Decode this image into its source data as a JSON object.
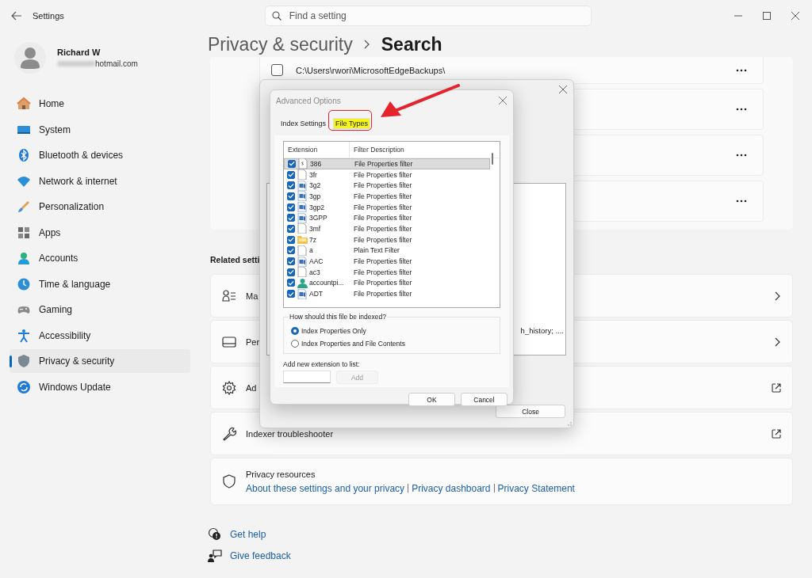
{
  "window": {
    "title": "Settings"
  },
  "search": {
    "placeholder": "Find a setting"
  },
  "profile": {
    "name": "Richard W",
    "email": "hotmail.com"
  },
  "nav": [
    {
      "label": "Home",
      "selected": false
    },
    {
      "label": "System",
      "selected": false
    },
    {
      "label": "Bluetooth & devices",
      "selected": false
    },
    {
      "label": "Network & internet",
      "selected": false
    },
    {
      "label": "Personalization",
      "selected": false
    },
    {
      "label": "Apps",
      "selected": false
    },
    {
      "label": "Accounts",
      "selected": false
    },
    {
      "label": "Time & language",
      "selected": false
    },
    {
      "label": "Gaming",
      "selected": false
    },
    {
      "label": "Accessibility",
      "selected": false
    },
    {
      "label": "Privacy & security",
      "selected": true
    },
    {
      "label": "Windows Update",
      "selected": false
    }
  ],
  "breadcrumb": {
    "parent": "Privacy & security",
    "current": "Search"
  },
  "folder_rows": [
    {
      "kind": "path",
      "path": "C:\\Users\\rwori\\MicrosoftEdgeBackups\\",
      "checked": false
    },
    {
      "kind": "covered"
    },
    {
      "kind": "covered"
    },
    {
      "kind": "covered"
    }
  ],
  "related_settings": {
    "title": "Related setti",
    "items": [
      {
        "label": "Ma",
        "kind": "page"
      },
      {
        "label": "Per",
        "kind": "page"
      },
      {
        "label": "Ad",
        "kind": "external"
      },
      {
        "label": "Indexer troubleshooter",
        "kind": "external"
      }
    ]
  },
  "privacy_resources": {
    "title": "Privacy resources",
    "links": [
      "About these settings and your privacy",
      "Privacy dashboard",
      "Privacy Statement"
    ]
  },
  "footer_links": [
    "Get help",
    "Give feedback"
  ],
  "indexing_dialog": {
    "list_text": "h_history; ....",
    "close_button": "Close"
  },
  "advanced_dialog": {
    "title": "Advanced Options",
    "tabs": [
      {
        "label": "Index Settings",
        "selected": false,
        "highlighted": false
      },
      {
        "label": "File Types",
        "selected": true,
        "highlighted": true
      }
    ],
    "columns": [
      "Extension",
      "Filter Description"
    ],
    "file_types": [
      {
        "extension": "386",
        "filter": "File Properties filter",
        "kind": "config",
        "checked": true,
        "selected": true
      },
      {
        "extension": "3fr",
        "filter": "File Properties filter",
        "kind": "doc",
        "checked": true,
        "selected": false
      },
      {
        "extension": "3g2",
        "filter": "File Properties filter",
        "kind": "media",
        "checked": true,
        "selected": false
      },
      {
        "extension": "3gp",
        "filter": "File Properties filter",
        "kind": "media",
        "checked": true,
        "selected": false
      },
      {
        "extension": "3gp2",
        "filter": "File Properties filter",
        "kind": "media",
        "checked": true,
        "selected": false
      },
      {
        "extension": "3GPP",
        "filter": "File Properties filter",
        "kind": "media",
        "checked": true,
        "selected": false
      },
      {
        "extension": "3mf",
        "filter": "File Properties filter",
        "kind": "doc",
        "checked": true,
        "selected": false
      },
      {
        "extension": "7z",
        "filter": "File Properties filter",
        "kind": "folder",
        "checked": true,
        "selected": false
      },
      {
        "extension": "a",
        "filter": "Plain Text Filter",
        "kind": "doc",
        "checked": true,
        "selected": false
      },
      {
        "extension": "AAC",
        "filter": "File Properties filter",
        "kind": "media",
        "checked": true,
        "selected": false
      },
      {
        "extension": "ac3",
        "filter": "File Properties filter",
        "kind": "doc",
        "checked": true,
        "selected": false
      },
      {
        "extension": "accountpi...",
        "filter": "File Properties filter",
        "kind": "person",
        "checked": true,
        "selected": false
      },
      {
        "extension": "ADT",
        "filter": "File Properties filter",
        "kind": "media",
        "checked": true,
        "selected": false
      }
    ],
    "index_group": {
      "title": "How should this file be indexed?",
      "options": [
        {
          "label": "Index Properties Only",
          "selected": true
        },
        {
          "label": "Index Properties and File Contents",
          "selected": false
        }
      ]
    },
    "add_extension": {
      "label": "Add new extension to list:",
      "button": "Add",
      "button_disabled": true
    },
    "buttons": [
      "OK",
      "Cancel"
    ]
  }
}
